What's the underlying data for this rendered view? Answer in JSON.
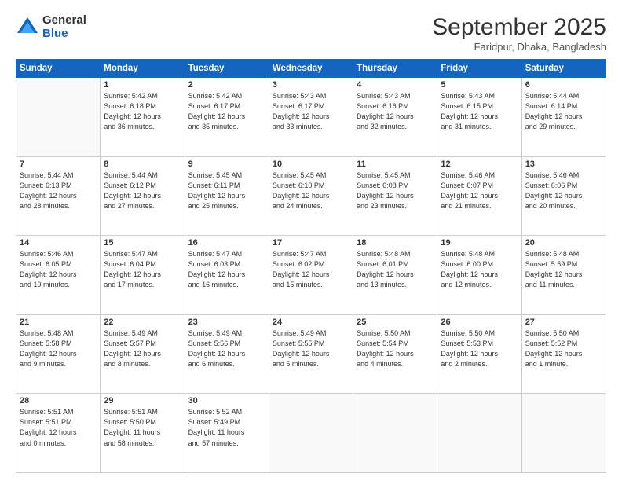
{
  "logo": {
    "general": "General",
    "blue": "Blue"
  },
  "header": {
    "month": "September 2025",
    "location": "Faridpur, Dhaka, Bangladesh"
  },
  "weekdays": [
    "Sunday",
    "Monday",
    "Tuesday",
    "Wednesday",
    "Thursday",
    "Friday",
    "Saturday"
  ],
  "weeks": [
    [
      {
        "day": "",
        "sunrise": "",
        "sunset": "",
        "daylight": "",
        "empty": true
      },
      {
        "day": "1",
        "sunrise": "Sunrise: 5:42 AM",
        "sunset": "Sunset: 6:18 PM",
        "daylight": "Daylight: 12 hours",
        "daylight2": "and 36 minutes."
      },
      {
        "day": "2",
        "sunrise": "Sunrise: 5:42 AM",
        "sunset": "Sunset: 6:17 PM",
        "daylight": "Daylight: 12 hours",
        "daylight2": "and 35 minutes."
      },
      {
        "day": "3",
        "sunrise": "Sunrise: 5:43 AM",
        "sunset": "Sunset: 6:17 PM",
        "daylight": "Daylight: 12 hours",
        "daylight2": "and 33 minutes."
      },
      {
        "day": "4",
        "sunrise": "Sunrise: 5:43 AM",
        "sunset": "Sunset: 6:16 PM",
        "daylight": "Daylight: 12 hours",
        "daylight2": "and 32 minutes."
      },
      {
        "day": "5",
        "sunrise": "Sunrise: 5:43 AM",
        "sunset": "Sunset: 6:15 PM",
        "daylight": "Daylight: 12 hours",
        "daylight2": "and 31 minutes."
      },
      {
        "day": "6",
        "sunrise": "Sunrise: 5:44 AM",
        "sunset": "Sunset: 6:14 PM",
        "daylight": "Daylight: 12 hours",
        "daylight2": "and 29 minutes."
      }
    ],
    [
      {
        "day": "7",
        "sunrise": "Sunrise: 5:44 AM",
        "sunset": "Sunset: 6:13 PM",
        "daylight": "Daylight: 12 hours",
        "daylight2": "and 28 minutes."
      },
      {
        "day": "8",
        "sunrise": "Sunrise: 5:44 AM",
        "sunset": "Sunset: 6:12 PM",
        "daylight": "Daylight: 12 hours",
        "daylight2": "and 27 minutes."
      },
      {
        "day": "9",
        "sunrise": "Sunrise: 5:45 AM",
        "sunset": "Sunset: 6:11 PM",
        "daylight": "Daylight: 12 hours",
        "daylight2": "and 25 minutes."
      },
      {
        "day": "10",
        "sunrise": "Sunrise: 5:45 AM",
        "sunset": "Sunset: 6:10 PM",
        "daylight": "Daylight: 12 hours",
        "daylight2": "and 24 minutes."
      },
      {
        "day": "11",
        "sunrise": "Sunrise: 5:45 AM",
        "sunset": "Sunset: 6:08 PM",
        "daylight": "Daylight: 12 hours",
        "daylight2": "and 23 minutes."
      },
      {
        "day": "12",
        "sunrise": "Sunrise: 5:46 AM",
        "sunset": "Sunset: 6:07 PM",
        "daylight": "Daylight: 12 hours",
        "daylight2": "and 21 minutes."
      },
      {
        "day": "13",
        "sunrise": "Sunrise: 5:46 AM",
        "sunset": "Sunset: 6:06 PM",
        "daylight": "Daylight: 12 hours",
        "daylight2": "and 20 minutes."
      }
    ],
    [
      {
        "day": "14",
        "sunrise": "Sunrise: 5:46 AM",
        "sunset": "Sunset: 6:05 PM",
        "daylight": "Daylight: 12 hours",
        "daylight2": "and 19 minutes."
      },
      {
        "day": "15",
        "sunrise": "Sunrise: 5:47 AM",
        "sunset": "Sunset: 6:04 PM",
        "daylight": "Daylight: 12 hours",
        "daylight2": "and 17 minutes."
      },
      {
        "day": "16",
        "sunrise": "Sunrise: 5:47 AM",
        "sunset": "Sunset: 6:03 PM",
        "daylight": "Daylight: 12 hours",
        "daylight2": "and 16 minutes."
      },
      {
        "day": "17",
        "sunrise": "Sunrise: 5:47 AM",
        "sunset": "Sunset: 6:02 PM",
        "daylight": "Daylight: 12 hours",
        "daylight2": "and 15 minutes."
      },
      {
        "day": "18",
        "sunrise": "Sunrise: 5:48 AM",
        "sunset": "Sunset: 6:01 PM",
        "daylight": "Daylight: 12 hours",
        "daylight2": "and 13 minutes."
      },
      {
        "day": "19",
        "sunrise": "Sunrise: 5:48 AM",
        "sunset": "Sunset: 6:00 PM",
        "daylight": "Daylight: 12 hours",
        "daylight2": "and 12 minutes."
      },
      {
        "day": "20",
        "sunrise": "Sunrise: 5:48 AM",
        "sunset": "Sunset: 5:59 PM",
        "daylight": "Daylight: 12 hours",
        "daylight2": "and 11 minutes."
      }
    ],
    [
      {
        "day": "21",
        "sunrise": "Sunrise: 5:48 AM",
        "sunset": "Sunset: 5:58 PM",
        "daylight": "Daylight: 12 hours",
        "daylight2": "and 9 minutes."
      },
      {
        "day": "22",
        "sunrise": "Sunrise: 5:49 AM",
        "sunset": "Sunset: 5:57 PM",
        "daylight": "Daylight: 12 hours",
        "daylight2": "and 8 minutes."
      },
      {
        "day": "23",
        "sunrise": "Sunrise: 5:49 AM",
        "sunset": "Sunset: 5:56 PM",
        "daylight": "Daylight: 12 hours",
        "daylight2": "and 6 minutes."
      },
      {
        "day": "24",
        "sunrise": "Sunrise: 5:49 AM",
        "sunset": "Sunset: 5:55 PM",
        "daylight": "Daylight: 12 hours",
        "daylight2": "and 5 minutes."
      },
      {
        "day": "25",
        "sunrise": "Sunrise: 5:50 AM",
        "sunset": "Sunset: 5:54 PM",
        "daylight": "Daylight: 12 hours",
        "daylight2": "and 4 minutes."
      },
      {
        "day": "26",
        "sunrise": "Sunrise: 5:50 AM",
        "sunset": "Sunset: 5:53 PM",
        "daylight": "Daylight: 12 hours",
        "daylight2": "and 2 minutes."
      },
      {
        "day": "27",
        "sunrise": "Sunrise: 5:50 AM",
        "sunset": "Sunset: 5:52 PM",
        "daylight": "Daylight: 12 hours",
        "daylight2": "and 1 minute."
      }
    ],
    [
      {
        "day": "28",
        "sunrise": "Sunrise: 5:51 AM",
        "sunset": "Sunset: 5:51 PM",
        "daylight": "Daylight: 12 hours",
        "daylight2": "and 0 minutes."
      },
      {
        "day": "29",
        "sunrise": "Sunrise: 5:51 AM",
        "sunset": "Sunset: 5:50 PM",
        "daylight": "Daylight: 11 hours",
        "daylight2": "and 58 minutes."
      },
      {
        "day": "30",
        "sunrise": "Sunrise: 5:52 AM",
        "sunset": "Sunset: 5:49 PM",
        "daylight": "Daylight: 11 hours",
        "daylight2": "and 57 minutes."
      },
      {
        "day": "",
        "sunrise": "",
        "sunset": "",
        "daylight": "",
        "daylight2": "",
        "empty": true
      },
      {
        "day": "",
        "sunrise": "",
        "sunset": "",
        "daylight": "",
        "daylight2": "",
        "empty": true
      },
      {
        "day": "",
        "sunrise": "",
        "sunset": "",
        "daylight": "",
        "daylight2": "",
        "empty": true
      },
      {
        "day": "",
        "sunrise": "",
        "sunset": "",
        "daylight": "",
        "daylight2": "",
        "empty": true
      }
    ]
  ]
}
